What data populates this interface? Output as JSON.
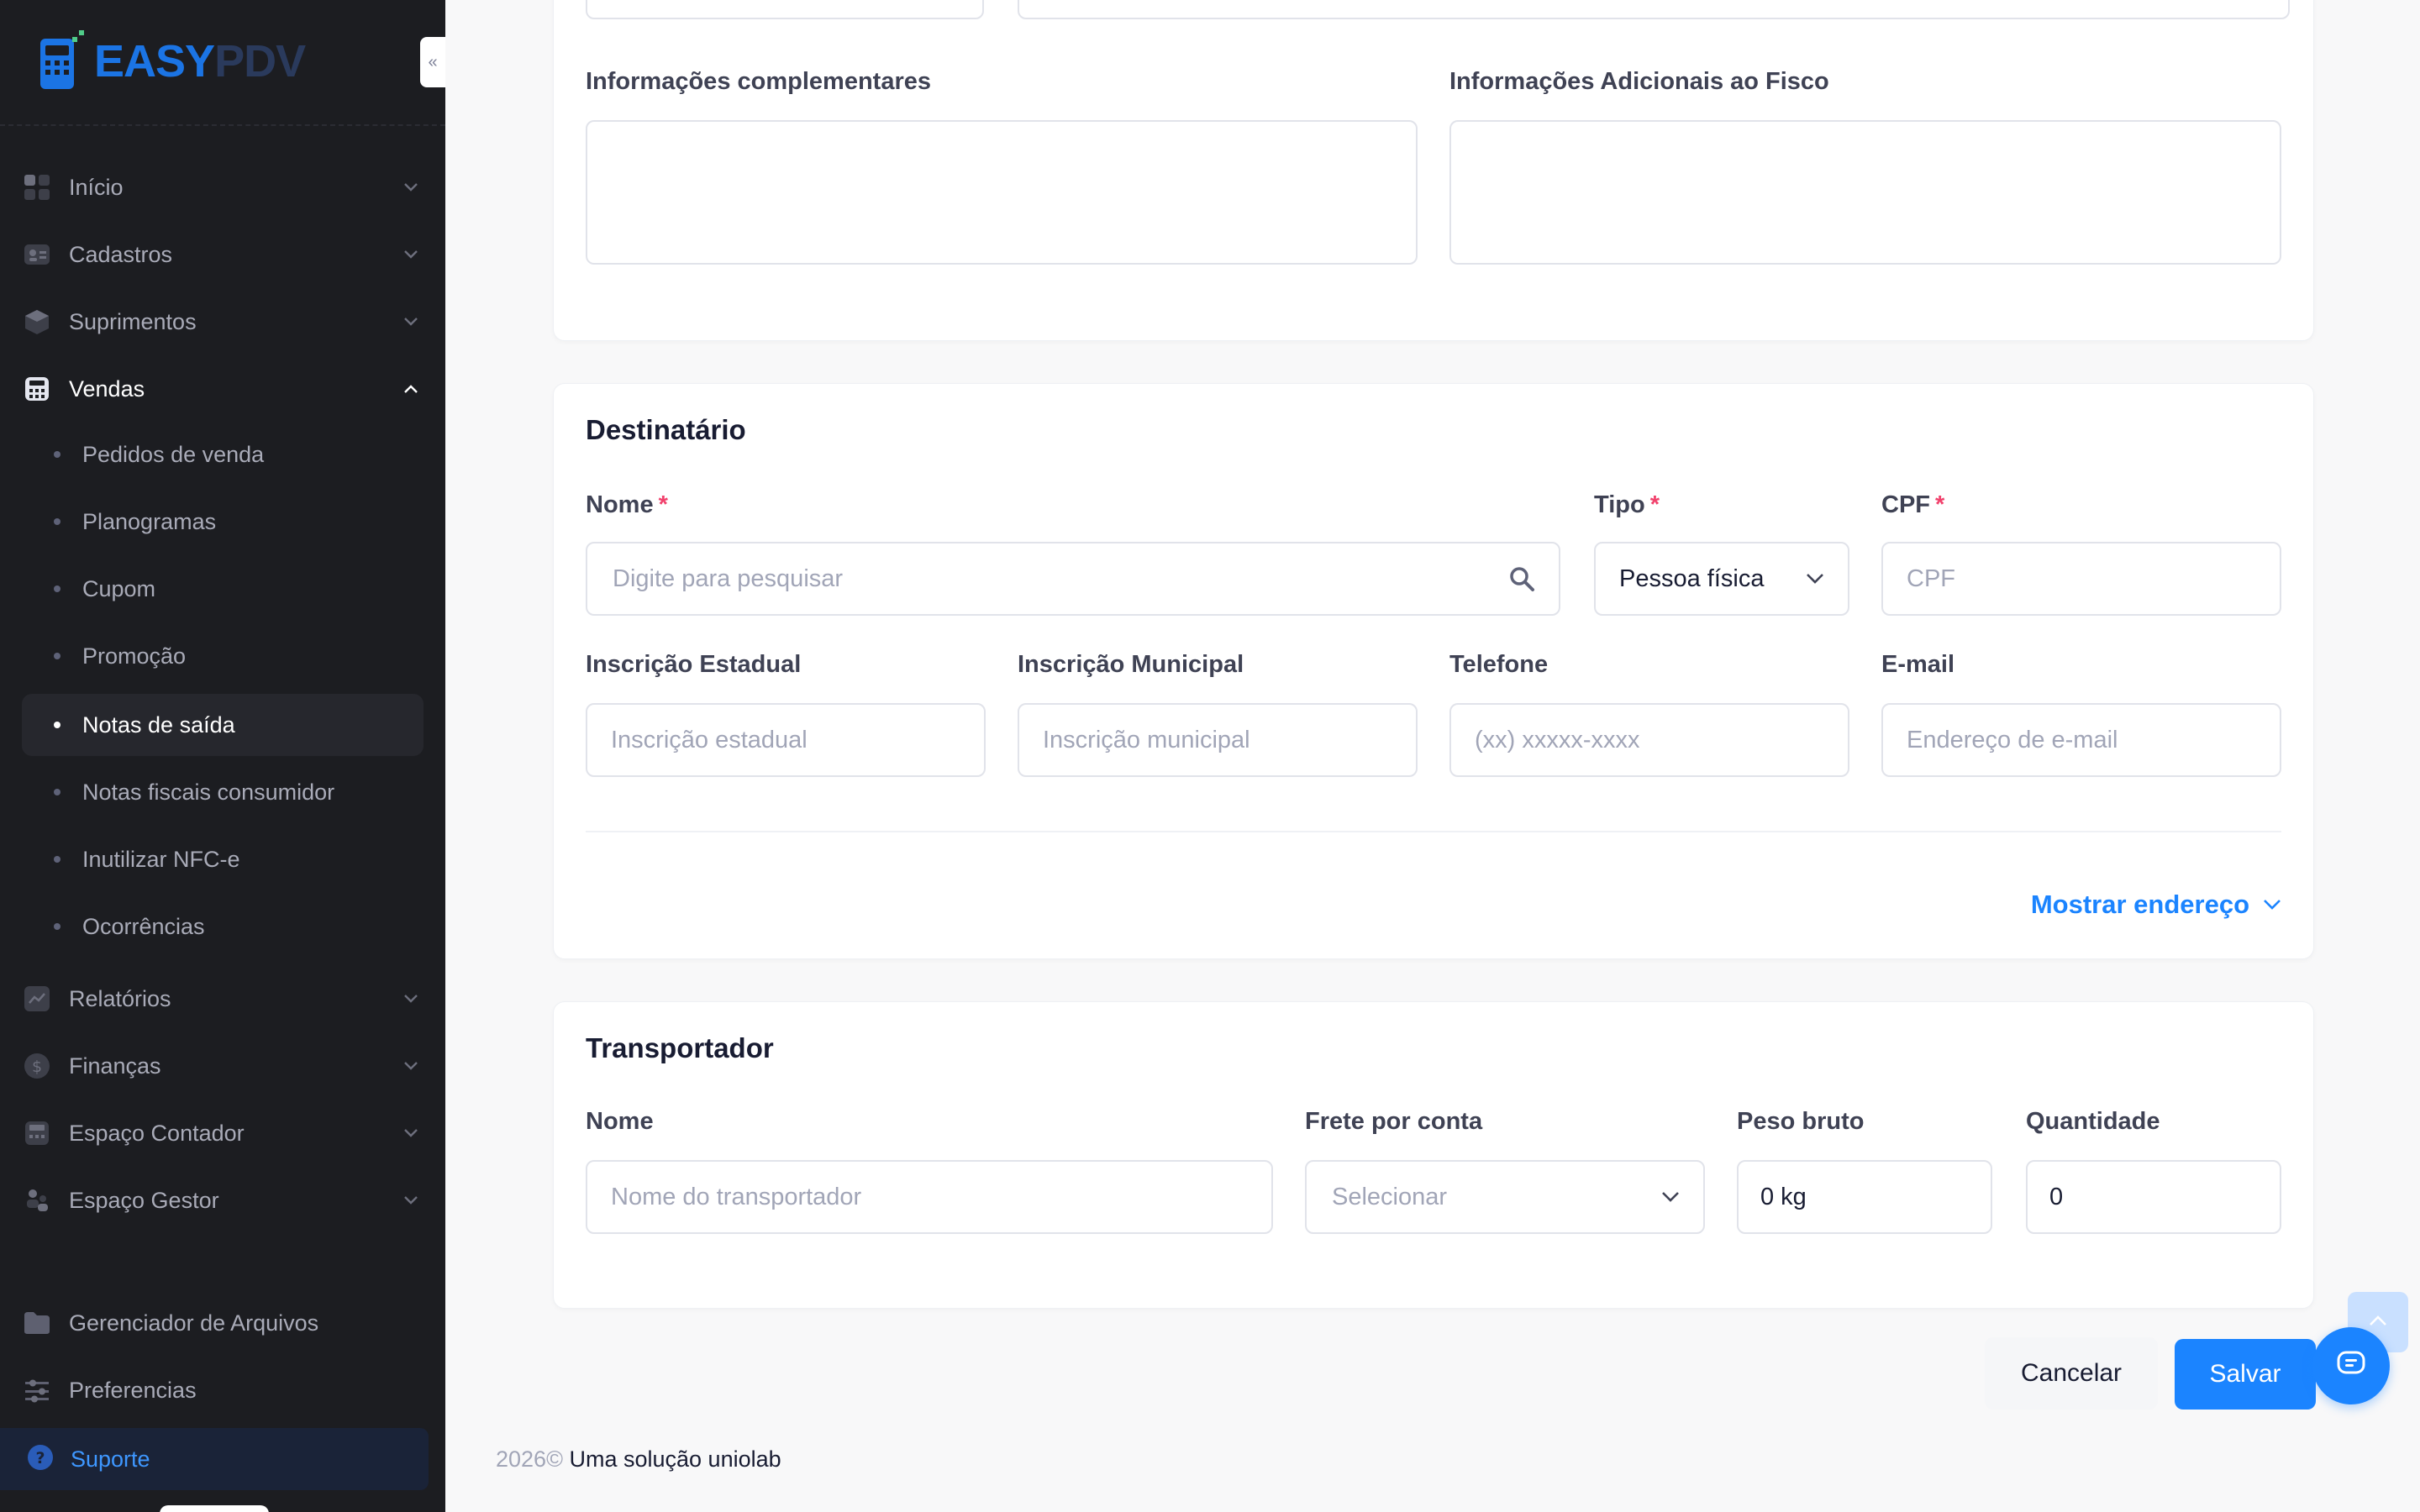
{
  "brand": {
    "part1": "EASY",
    "part2": "PDV",
    "color_primary": "#1b74e4",
    "color_secondary": "#2a3a5c"
  },
  "sidebar": {
    "items": [
      {
        "label": "Início",
        "icon": "dashboard-icon"
      },
      {
        "label": "Cadastros",
        "icon": "id-card-icon"
      },
      {
        "label": "Suprimentos",
        "icon": "box-icon"
      },
      {
        "label": "Vendas",
        "icon": "calculator-icon",
        "expanded": true
      }
    ],
    "sub_items": [
      {
        "label": "Pedidos de venda"
      },
      {
        "label": "Planogramas"
      },
      {
        "label": "Cupom"
      },
      {
        "label": "Promoção"
      },
      {
        "label": "Notas de saída",
        "active": true
      },
      {
        "label": "Notas fiscais consumidor"
      },
      {
        "label": "Inutilizar NFC-e"
      },
      {
        "label": "Ocorrências"
      }
    ],
    "items_after": [
      {
        "label": "Relatórios",
        "icon": "chart-icon"
      },
      {
        "label": "Finanças",
        "icon": "dollar-icon"
      },
      {
        "label": "Espaço Contador",
        "icon": "calculator-icon"
      },
      {
        "label": "Espaço Gestor",
        "icon": "people-icon"
      }
    ],
    "bottom": [
      {
        "label": "Gerenciador de Arquivos",
        "icon": "folder-icon"
      },
      {
        "label": "Preferencias",
        "icon": "sliders-icon"
      }
    ],
    "support": {
      "label": "Suporte",
      "icon": "question-icon"
    }
  },
  "info": {
    "complementares_label": "Informações complementares",
    "fisco_label": "Informações Adicionais ao Fisco"
  },
  "destinatario": {
    "title": "Destinatário",
    "nome_label": "Nome",
    "nome_placeholder": "Digite para pesquisar",
    "tipo_label": "Tipo",
    "tipo_value": "Pessoa física",
    "cpf_label": "CPF",
    "cpf_placeholder": "CPF",
    "ie_label": "Inscrição Estadual",
    "ie_placeholder": "Inscrição estadual",
    "im_label": "Inscrição Municipal",
    "im_placeholder": "Inscrição municipal",
    "tel_label": "Telefone",
    "tel_placeholder": "(xx) xxxxx-xxxx",
    "email_label": "E-mail",
    "email_placeholder": "Endereço de e-mail",
    "show_address": "Mostrar endereço",
    "required_mark": "*"
  },
  "transportador": {
    "title": "Transportador",
    "nome_label": "Nome",
    "nome_placeholder": "Nome do transportador",
    "frete_label": "Frete por conta",
    "frete_placeholder": "Selecionar",
    "peso_label": "Peso bruto",
    "peso_value": "0 kg",
    "qtd_label": "Quantidade",
    "qtd_value": "0"
  },
  "actions": {
    "cancel": "Cancelar",
    "save": "Salvar"
  },
  "footer": {
    "year": "2026©",
    "text": "Uma solução uniolab"
  },
  "colors": {
    "accent": "#1b84ff",
    "required": "#f1416c",
    "sidebar_bg": "#1c1d21"
  }
}
